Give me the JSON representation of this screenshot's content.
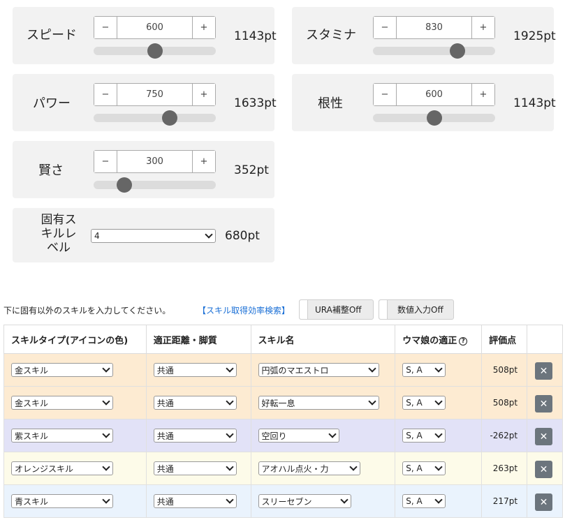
{
  "stats": {
    "speed": {
      "label": "スピード",
      "value": "600",
      "points": "1143pt",
      "level": 0.5
    },
    "stamina": {
      "label": "スタミナ",
      "value": "830",
      "points": "1925pt",
      "level": 0.69
    },
    "power": {
      "label": "パワー",
      "value": "750",
      "points": "1633pt",
      "level": 0.625
    },
    "guts": {
      "label": "根性",
      "value": "600",
      "points": "1143pt",
      "level": 0.5
    },
    "wisdom": {
      "label": "賢さ",
      "value": "300",
      "points": "352pt",
      "level": 0.25
    }
  },
  "stepper": {
    "minus": "−",
    "plus": "+"
  },
  "unique_skill": {
    "label": "固有スキルレベル",
    "value": "4",
    "points": "680pt"
  },
  "instruction": "下に固有以外のスキルを入力してください。",
  "efficiency_link": "【スキル取得効率検索】",
  "toggles": {
    "ura": "URA補整Off",
    "numeric": "数値入力Off"
  },
  "table": {
    "headers": {
      "type": "スキルタイプ(アイコンの色)",
      "distance": "適正距離・脚質",
      "name": "スキル名",
      "aptitude": "ウマ娘の適正",
      "help": "?",
      "score": "評価点"
    },
    "rows": [
      {
        "type": "金スキル",
        "distance": "共通",
        "name": "円弧のマエストロ",
        "aptitude": "S, A",
        "score": "508pt",
        "row_color": "#fdebd2"
      },
      {
        "type": "金スキル",
        "distance": "共通",
        "name": "好転一息",
        "aptitude": "S, A",
        "score": "508pt",
        "row_color": "#fdebd2"
      },
      {
        "type": "紫スキル",
        "distance": "共通",
        "name": "空回り",
        "aptitude": "S, A",
        "score": "-262pt",
        "row_color": "#e2e2f7"
      },
      {
        "type": "オレンジスキル",
        "distance": "共通",
        "name": "アオハル点火・力",
        "aptitude": "S, A",
        "score": "263pt",
        "row_color": "#fdfbe9"
      },
      {
        "type": "青スキル",
        "distance": "共通",
        "name": "スリーセブン",
        "aptitude": "S, A",
        "score": "217pt",
        "row_color": "#eaf3fd"
      }
    ],
    "delete_label": "✕"
  },
  "colors": {
    "link": "#1a6fd6",
    "delete_button": "#6c757d",
    "card": "#f2f2f2"
  }
}
